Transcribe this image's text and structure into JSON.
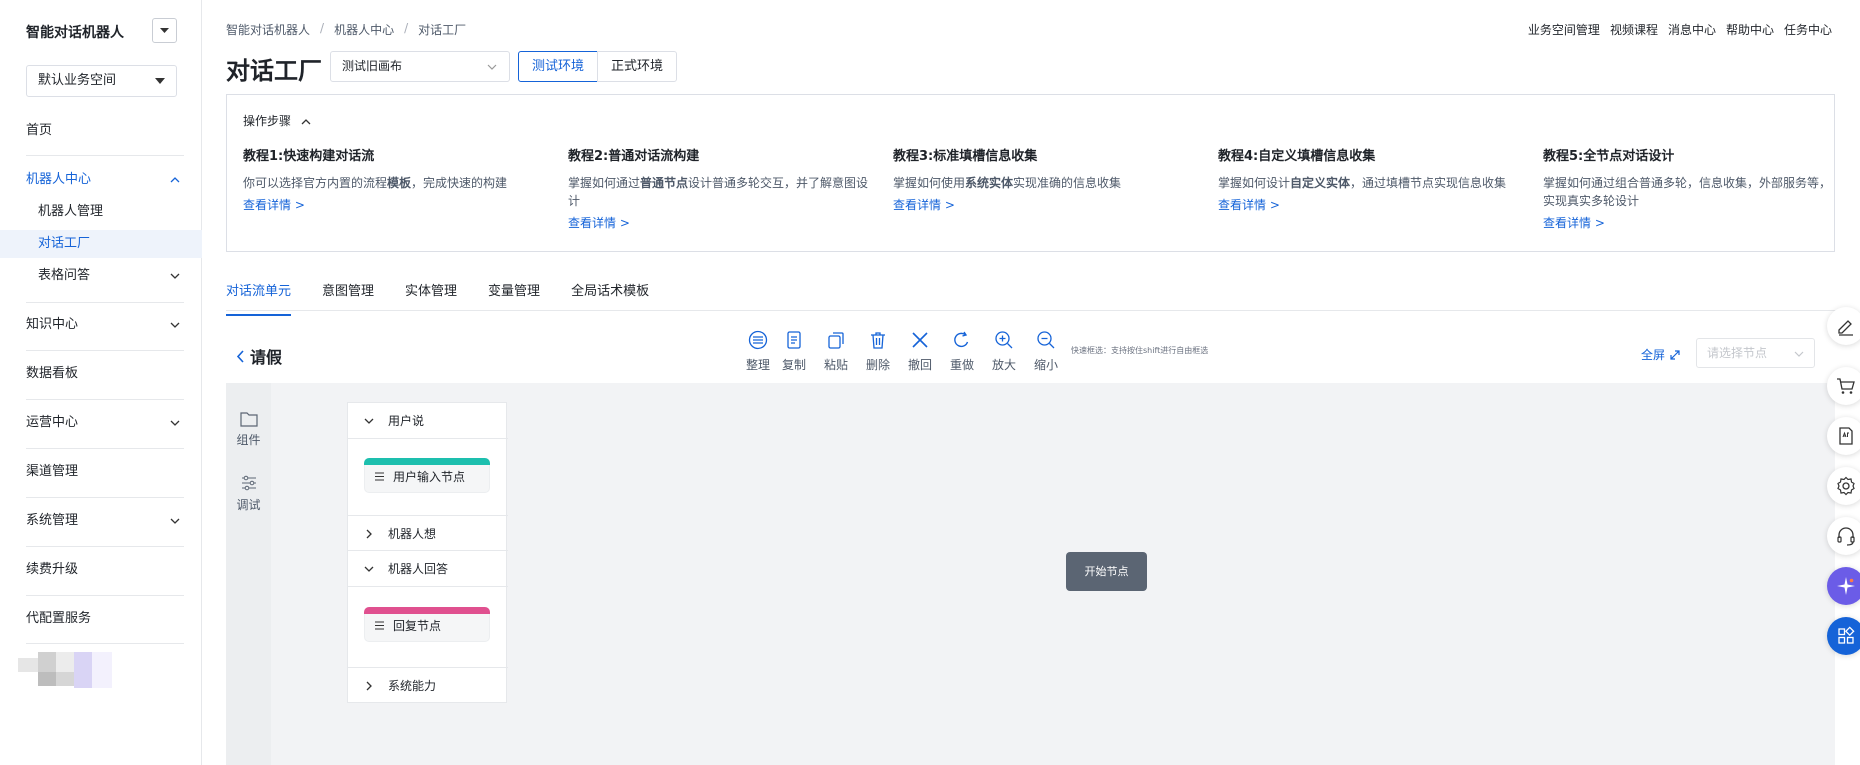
{
  "sidebar": {
    "app_title": "智能对话机器人",
    "space_select": "默认业务空间",
    "items": [
      {
        "label": "首页"
      },
      {
        "label": "机器人中心"
      },
      {
        "label": "机器人管理"
      },
      {
        "label": "对话工厂"
      },
      {
        "label": "表格问答"
      },
      {
        "label": "知识中心"
      },
      {
        "label": "数据看板"
      },
      {
        "label": "运营中心"
      },
      {
        "label": "渠道管理"
      },
      {
        "label": "系统管理"
      },
      {
        "label": "续费升级"
      },
      {
        "label": "代配置服务"
      }
    ]
  },
  "header": {
    "breadcrumb": [
      "智能对话机器人",
      "机器人中心",
      "对话工厂"
    ],
    "top_links": [
      "业务空间管理",
      "视频课程",
      "消息中心",
      "帮助中心",
      "任务中心"
    ],
    "page_title": "对话工厂",
    "canvas_select": "测试旧画布",
    "env_test": "测试环境",
    "env_prod": "正式环境"
  },
  "tutorial": {
    "heading": "操作步骤",
    "cards": [
      {
        "title": "教程1:快速构建对话流",
        "desc_pre": "你可以选择官方内置的流程",
        "desc_bold": "模板",
        "desc_post": "，完成快速的构建",
        "link": "查看详情 >"
      },
      {
        "title": "教程2:普通对话流构建",
        "desc_pre": "掌握如何通过",
        "desc_bold": "普通节点",
        "desc_post": "设计普通多轮交互，并了解意图设计",
        "link": "查看详情 >"
      },
      {
        "title": "教程3:标准填槽信息收集",
        "desc_pre": "掌握如何使用",
        "desc_bold": "系统实体",
        "desc_post": "实现准确的信息收集",
        "link": "查看详情 >"
      },
      {
        "title": "教程4:自定义填槽信息收集",
        "desc_pre": "掌握如何设计",
        "desc_bold": "自定义实体",
        "desc_post": "，通过填槽节点实现信息收集",
        "link": "查看详情 >"
      },
      {
        "title": "教程5:全节点对话设计",
        "desc_pre": "掌握如何通过组合普通多轮，信息收集，外部服务等，实现真实多轮设计",
        "desc_bold": "",
        "desc_post": "",
        "link": "查看详情 >"
      }
    ]
  },
  "tabs": [
    "对话流单元",
    "意图管理",
    "实体管理",
    "变量管理",
    "全局话术模板"
  ],
  "flow": {
    "name": "请假",
    "toolbar": [
      {
        "label": "整理",
        "icon": "organize-icon"
      },
      {
        "label": "复制",
        "icon": "copy-icon"
      },
      {
        "label": "粘贴",
        "icon": "paste-icon"
      },
      {
        "label": "删除",
        "icon": "delete-icon"
      },
      {
        "label": "撤回",
        "icon": "undo-icon"
      },
      {
        "label": "重做",
        "icon": "redo-icon"
      },
      {
        "label": "放大",
        "icon": "zoom-in-icon"
      },
      {
        "label": "缩小",
        "icon": "zoom-out-icon"
      }
    ],
    "quick_select_hint": "快速框选：支持按住shift进行自由框选",
    "fullscreen": "全屏",
    "node_select_placeholder": "请选择节点",
    "side_tools": [
      "组件",
      "调试"
    ],
    "palette": {
      "user_says": "用户说",
      "user_input_node": "用户输入节点",
      "robot_thinks": "机器人想",
      "robot_replies": "机器人回答",
      "reply_node": "回复节点",
      "system_ability": "系统能力"
    },
    "start_node": "开始节点"
  },
  "colors": {
    "accent": "#1563d8",
    "user_node_bar": "#1dbfae",
    "reply_node_bar": "#e0508f",
    "start_node": "#5b6573"
  }
}
